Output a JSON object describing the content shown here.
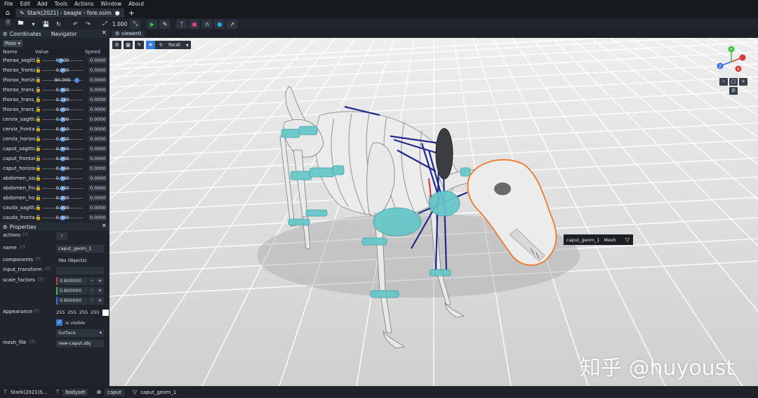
{
  "menu": [
    "File",
    "Edit",
    "Add",
    "Tools",
    "Actions",
    "Window",
    "About"
  ],
  "file_tab": {
    "label": "Stark(2021) - beagle - fore.osim",
    "modified": "●",
    "add": "+"
  },
  "toolbar": {
    "scale_value": "1.000"
  },
  "coordinates_panel": {
    "title": "Coordinates",
    "second_tab": "Navigator",
    "pose_label": "Pose",
    "columns": {
      "name": "Name",
      "value": "Value",
      "speed": "Speed"
    },
    "rows": [
      {
        "name": "thorax_sagittal",
        "value": "0.000",
        "speed": "0.0000",
        "pos": 0.45
      },
      {
        "name": "thorax_frontal",
        "value": "0.000",
        "speed": "0.0000",
        "pos": 0.5
      },
      {
        "name": "thorax_horizontal",
        "value": "90.000",
        "speed": "0.0000",
        "pos": 0.9
      },
      {
        "name": "thorax_trans_x",
        "value": "0.000",
        "speed": "0.0000",
        "pos": 0.5
      },
      {
        "name": "thorax_trans_y",
        "value": "0.230",
        "speed": "0.0000",
        "pos": 0.52
      },
      {
        "name": "thorax_trans_z",
        "value": "0.000",
        "speed": "0.0000",
        "pos": 0.5
      },
      {
        "name": "cervix_sagittal",
        "value": "0.000",
        "speed": "0.0000",
        "pos": 0.5
      },
      {
        "name": "cervix_frontal",
        "value": "0.000",
        "speed": "0.0000",
        "pos": 0.5
      },
      {
        "name": "cervix_horizontal",
        "value": "0.000",
        "speed": "0.0000",
        "pos": 0.5
      },
      {
        "name": "caput_sagittal",
        "value": "0.000",
        "speed": "0.0000",
        "pos": 0.5
      },
      {
        "name": "caput_frontal",
        "value": "0.000",
        "speed": "0.0000",
        "pos": 0.5
      },
      {
        "name": "caput_horizontal",
        "value": "0.000",
        "speed": "0.0000",
        "pos": 0.5
      },
      {
        "name": "abdomen_sagittal",
        "value": "0.000",
        "speed": "0.0000",
        "pos": 0.5
      },
      {
        "name": "abdomen_frontal",
        "value": "0.000",
        "speed": "0.0000",
        "pos": 0.5
      },
      {
        "name": "abdomen_horizontal",
        "value": "0.000",
        "speed": "0.0000",
        "pos": 0.5
      },
      {
        "name": "cauda_sagittal",
        "value": "0.000",
        "speed": "0.0000",
        "pos": 0.5
      },
      {
        "name": "cauda_frontal",
        "value": "0.000",
        "speed": "0.0000",
        "pos": 0.5
      }
    ]
  },
  "properties_panel": {
    "title": "Properties",
    "q": "(?)",
    "actions_label": "actions",
    "name_label": "name",
    "name_value": "caput_geom_1",
    "components_label": "components",
    "components_value": "(No Objects)",
    "input_transform_label": "input_transform",
    "scale_factors_label": "scale_factors",
    "scale_factors": [
      "0.800000",
      "0.800000",
      "0.800000"
    ],
    "appearance_label": "Appearance",
    "rgba": [
      "255",
      "255",
      "255"
    ],
    "is_visible_label": "is visible",
    "representation": "Surface",
    "mesh_file_label": "mesh_file",
    "mesh_file_value": "new-caput.obj"
  },
  "viewer": {
    "tab_label": "viewer0",
    "camera_mode": "focal",
    "tooltip_name": "caput_geom_1",
    "tooltip_type": "Mesh",
    "axis_labels": {
      "x": "X",
      "y": "Y",
      "z": "Z"
    }
  },
  "watermark": "知乎 @huyoust",
  "statusbar": {
    "crumbs": [
      "Stark(2021)S...",
      "bodyset",
      "caput",
      "caput_geom_1"
    ]
  },
  "colors": {
    "accent": "#2f7de0",
    "selection": "#f07a2a",
    "muscle": "#1f2a8c"
  }
}
